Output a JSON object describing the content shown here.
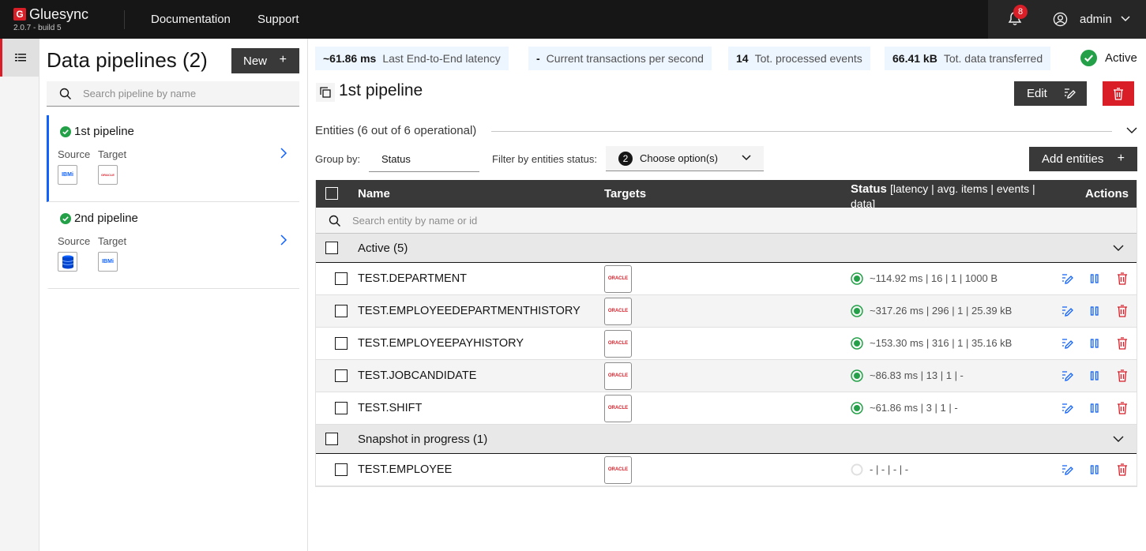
{
  "app": {
    "name": "Gluesync",
    "logo_letter": "G",
    "version": "2.0.7 - build 5",
    "nav": [
      "Documentation",
      "Support"
    ],
    "notifications": "8",
    "user": "admin"
  },
  "pipelines_panel": {
    "title": "Data pipelines (2)",
    "new_label": "New",
    "search_placeholder": "Search pipeline by name",
    "pipelines": [
      {
        "name": "1st pipeline",
        "source_label": "Source",
        "target_label": "Target",
        "source_logo": "IBMi",
        "target_logo": "ORACLE"
      },
      {
        "name": "2nd pipeline",
        "source_label": "Source",
        "target_label": "Target",
        "source_logo": "database-icon",
        "target_logo": "IBMi"
      }
    ]
  },
  "metrics": [
    {
      "value": "~61.86 ms",
      "label": "Last End-to-End latency"
    },
    {
      "value": "-",
      "label": "Current transactions per second"
    },
    {
      "value": "14",
      "label": "Tot. processed events"
    },
    {
      "value": "66.41 kB",
      "label": "Tot. data transferred"
    }
  ],
  "pipeline_status": "Active",
  "pipeline_title": "1st pipeline",
  "edit_label": "Edit",
  "entities": {
    "title": "Entities (6 out of 6 operational)",
    "group_by_label": "Group by:",
    "group_by_value": "Status",
    "filter_label": "Filter by entities status:",
    "filter_count": "2",
    "filter_value": "Choose option(s)",
    "add_label": "Add entities"
  },
  "table": {
    "headers": {
      "name": "Name",
      "targets": "Targets",
      "status": "Status",
      "status_sub": "[latency | avg. items | events | data]",
      "actions": "Actions"
    },
    "search_placeholder": "Search entity by name or id",
    "groups": [
      {
        "label": "Active (5)",
        "rows": [
          {
            "name": "TEST.DEPARTMENT",
            "status": "~114.92 ms | 16 | 1 | 1000 B",
            "state": "active"
          },
          {
            "name": "TEST.EMPLOYEEDEPARTMENTHISTORY",
            "status": "~317.26 ms | 296 | 1 | 25.39 kB",
            "state": "active"
          },
          {
            "name": "TEST.EMPLOYEEPAYHISTORY",
            "status": "~153.30 ms | 316 | 1 | 35.16 kB",
            "state": "active"
          },
          {
            "name": "TEST.JOBCANDIDATE",
            "status": "~86.83 ms | 13 | 1 | -",
            "state": "active"
          },
          {
            "name": "TEST.SHIFT",
            "status": "~61.86 ms | 3 | 1 | -",
            "state": "active"
          }
        ]
      },
      {
        "label": "Snapshot in progress (1)",
        "rows": [
          {
            "name": "TEST.EMPLOYEE",
            "status": "- | - | - | -",
            "state": "snapshot"
          }
        ]
      }
    ]
  },
  "colors": {
    "brand": "#da1e28",
    "dark": "#161616",
    "active_green": "#24a148",
    "action_blue": "#0f62fe",
    "danger": "#da1e28"
  }
}
